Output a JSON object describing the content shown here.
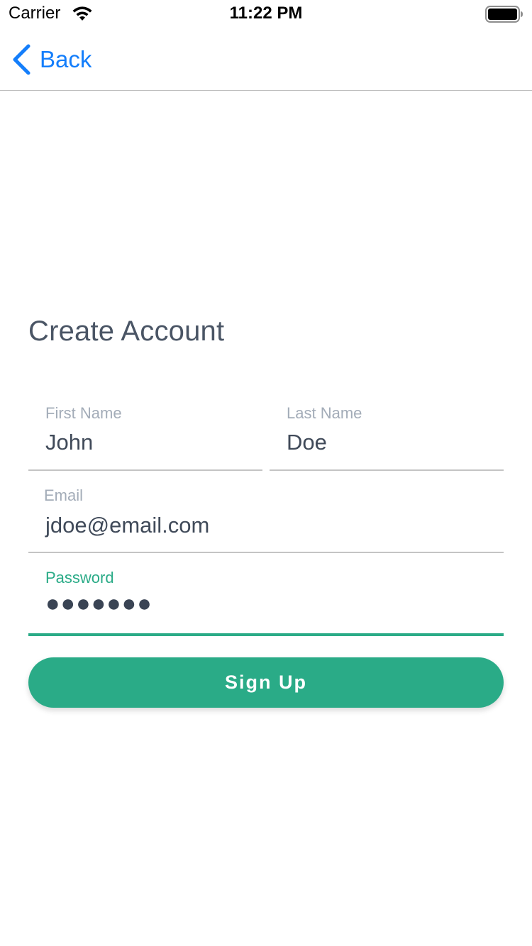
{
  "status_bar": {
    "carrier": "Carrier",
    "time": "11:22 PM",
    "wifi_icon": "wifi-icon",
    "battery_icon": "battery-icon"
  },
  "nav": {
    "back_label": "Back",
    "back_icon": "chevron-left-icon",
    "accent_color": "#147efb"
  },
  "page": {
    "title": "Create Account"
  },
  "form": {
    "first_name": {
      "label": "First Name",
      "value": "John"
    },
    "last_name": {
      "label": "Last Name",
      "value": "Doe"
    },
    "email": {
      "label": "Email",
      "value": "jdoe@email.com"
    },
    "password": {
      "label": "Password",
      "value": "●●●●●●●",
      "focused": true
    }
  },
  "actions": {
    "signup_label": "Sign Up"
  },
  "colors": {
    "primary": "#2aab87",
    "label": "#a3acb8",
    "text": "#404a59",
    "title": "#4a5565"
  }
}
